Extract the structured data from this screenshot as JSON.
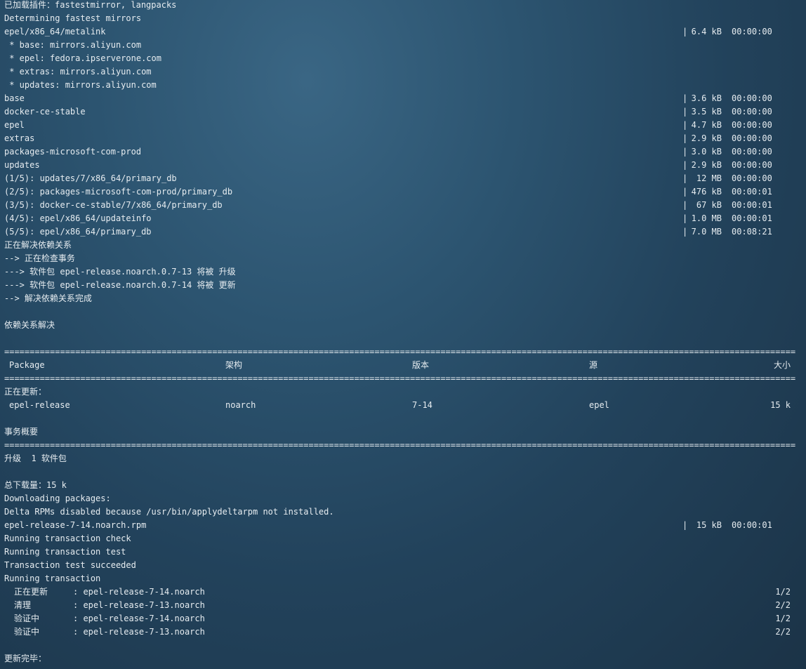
{
  "terminal": {
    "lines": [
      {
        "row": 0,
        "text": "已加载插件：fastestmirror, langpacks"
      },
      {
        "row": 1,
        "text": "Determining fastest mirrors"
      },
      {
        "row": 2,
        "text": "epel/x86_64/metalink",
        "size": "6.4 kB",
        "time": "00:00:00"
      },
      {
        "row": 3,
        "text": " * base: mirrors.aliyun.com"
      },
      {
        "row": 4,
        "text": " * epel: fedora.ipserverone.com"
      },
      {
        "row": 5,
        "text": " * extras: mirrors.aliyun.com"
      },
      {
        "row": 6,
        "text": " * updates: mirrors.aliyun.com"
      },
      {
        "row": 7,
        "text": "base",
        "size": "3.6 kB",
        "time": "00:00:00"
      },
      {
        "row": 8,
        "text": "docker-ce-stable",
        "size": "3.5 kB",
        "time": "00:00:00"
      },
      {
        "row": 9,
        "text": "epel",
        "size": "4.7 kB",
        "time": "00:00:00"
      },
      {
        "row": 10,
        "text": "extras",
        "size": "2.9 kB",
        "time": "00:00:00"
      },
      {
        "row": 11,
        "text": "packages-microsoft-com-prod",
        "size": "3.0 kB",
        "time": "00:00:00"
      },
      {
        "row": 12,
        "text": "updates",
        "size": "2.9 kB",
        "time": "00:00:00"
      },
      {
        "row": 13,
        "text": "(1/5): updates/7/x86_64/primary_db",
        "size": "12 MB",
        "time": "00:00:00"
      },
      {
        "row": 14,
        "text": "(2/5): packages-microsoft-com-prod/primary_db",
        "size": "476 kB",
        "time": "00:00:01"
      },
      {
        "row": 15,
        "text": "(3/5): docker-ce-stable/7/x86_64/primary_db",
        "size": "67 kB",
        "time": "00:00:01"
      },
      {
        "row": 16,
        "text": "(4/5): epel/x86_64/updateinfo",
        "size": "1.0 MB",
        "time": "00:00:01"
      },
      {
        "row": 17,
        "text": "(5/5): epel/x86_64/primary_db",
        "size": "7.0 MB",
        "time": "00:08:21"
      },
      {
        "row": 18,
        "text": "正在解决依赖关系"
      },
      {
        "row": 19,
        "text": "--> 正在检查事务"
      },
      {
        "row": 20,
        "text": "---> 软件包 epel-release.noarch.0.7-13 将被 升级"
      },
      {
        "row": 21,
        "text": "---> 软件包 epel-release.noarch.0.7-14 将被 更新"
      },
      {
        "row": 22,
        "text": "--> 解决依赖关系完成"
      },
      {
        "row": 24,
        "text": "依赖关系解决"
      },
      {
        "row": 29,
        "text": "正在更新："
      },
      {
        "row": 32,
        "text": "事务概要"
      },
      {
        "row": 34,
        "text": "升级  1 软件包"
      },
      {
        "row": 36,
        "text": "总下载量：15 k"
      },
      {
        "row": 37,
        "text": "Downloading packages:"
      },
      {
        "row": 38,
        "text": "Delta RPMs disabled because /usr/bin/applydeltarpm not installed."
      },
      {
        "row": 39,
        "text": "epel-release-7-14.noarch.rpm",
        "size": "15 kB",
        "time": "00:00:01"
      },
      {
        "row": 40,
        "text": "Running transaction check"
      },
      {
        "row": 41,
        "text": "Running transaction test"
      },
      {
        "row": 42,
        "text": "Transaction test succeeded"
      },
      {
        "row": 43,
        "text": "Running transaction"
      },
      {
        "row": 49,
        "text": "更新完毕："
      }
    ],
    "separator": "================================================================================================================================================================================================================================================",
    "separator_rows": [
      26,
      28,
      33
    ],
    "table_header": {
      "row": 27,
      "package": "Package",
      "arch": "架构",
      "version": "版本",
      "repo": "源",
      "size": "大小"
    },
    "table_rows": [
      {
        "row": 30,
        "package": "epel-release",
        "arch": "noarch",
        "version": "7-14",
        "repo": "epel",
        "size": "15 k"
      }
    ],
    "transaction_steps": [
      {
        "row": 44,
        "action": "正在更新",
        "package": ": epel-release-7-14.noarch",
        "progress": "1/2"
      },
      {
        "row": 45,
        "action": "清理",
        "package": ": epel-release-7-13.noarch",
        "progress": "2/2"
      },
      {
        "row": 46,
        "action": "验证中",
        "package": ": epel-release-7-14.noarch",
        "progress": "1/2"
      },
      {
        "row": 47,
        "action": "验证中",
        "package": ": epel-release-7-13.noarch",
        "progress": "2/2"
      }
    ]
  }
}
